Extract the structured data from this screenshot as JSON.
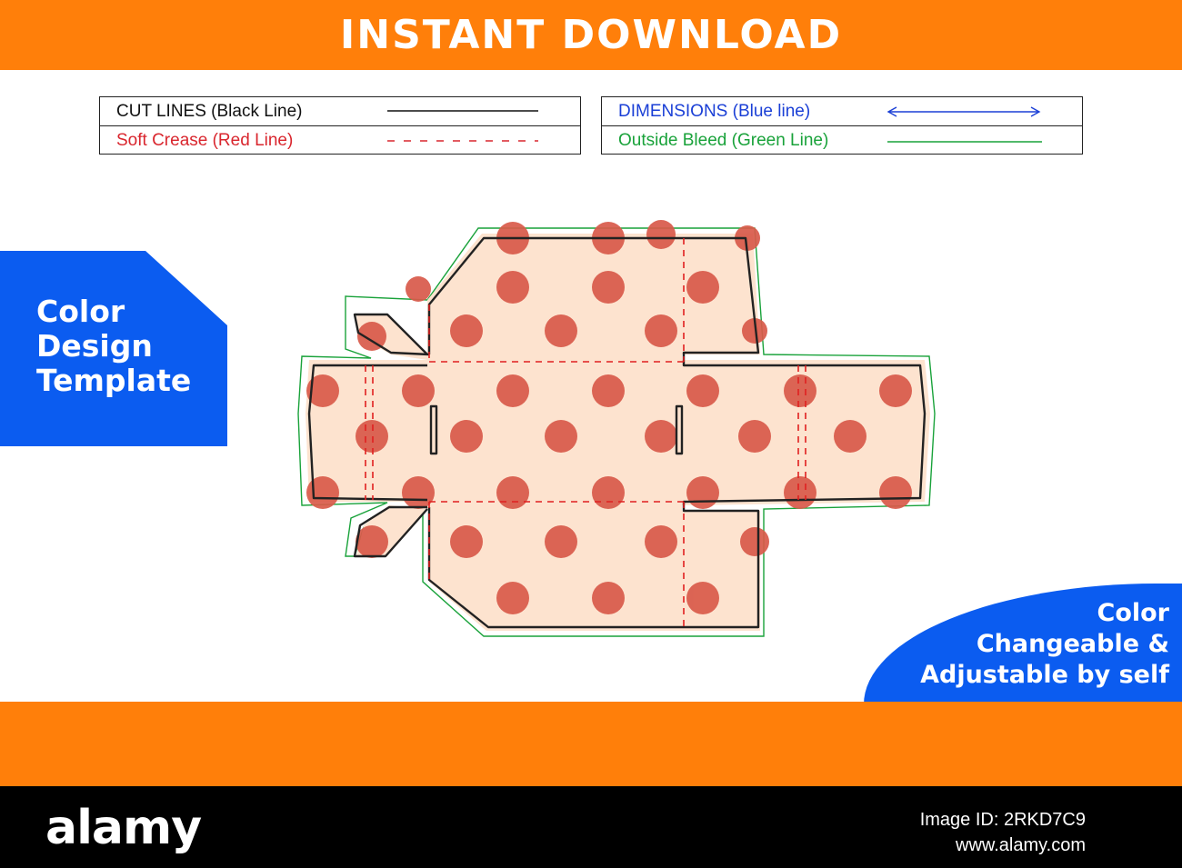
{
  "header": {
    "title": "INSTANT DOWNLOAD"
  },
  "legend": {
    "cut_lines": "CUT LINES (Black Line)",
    "soft_crease": "Soft Crease (Red Line)",
    "dimensions": "DIMENSIONS (Blue line)",
    "outside_bleed": "Outside Bleed (Green Line)"
  },
  "side_tag": {
    "line1": "Color",
    "line2": "Design",
    "line3": "Template"
  },
  "corner_tag": {
    "line1": "Color",
    "line2": "Changeable &",
    "line3": "Adjustable by self"
  },
  "footer": {
    "brand": "alamy",
    "image_id": "Image ID: 2RKD7C9",
    "site": "www.alamy.com"
  },
  "colors": {
    "banner": "#ff7f0a",
    "accent_blue": "#0b5cf0",
    "box_fill": "#fde3cf",
    "dot": "#d95a4a",
    "cut_line": "#222222",
    "crease_line": "#e02020",
    "bleed_line": "#19a23a",
    "dimension_line": "#1a3fd6"
  }
}
